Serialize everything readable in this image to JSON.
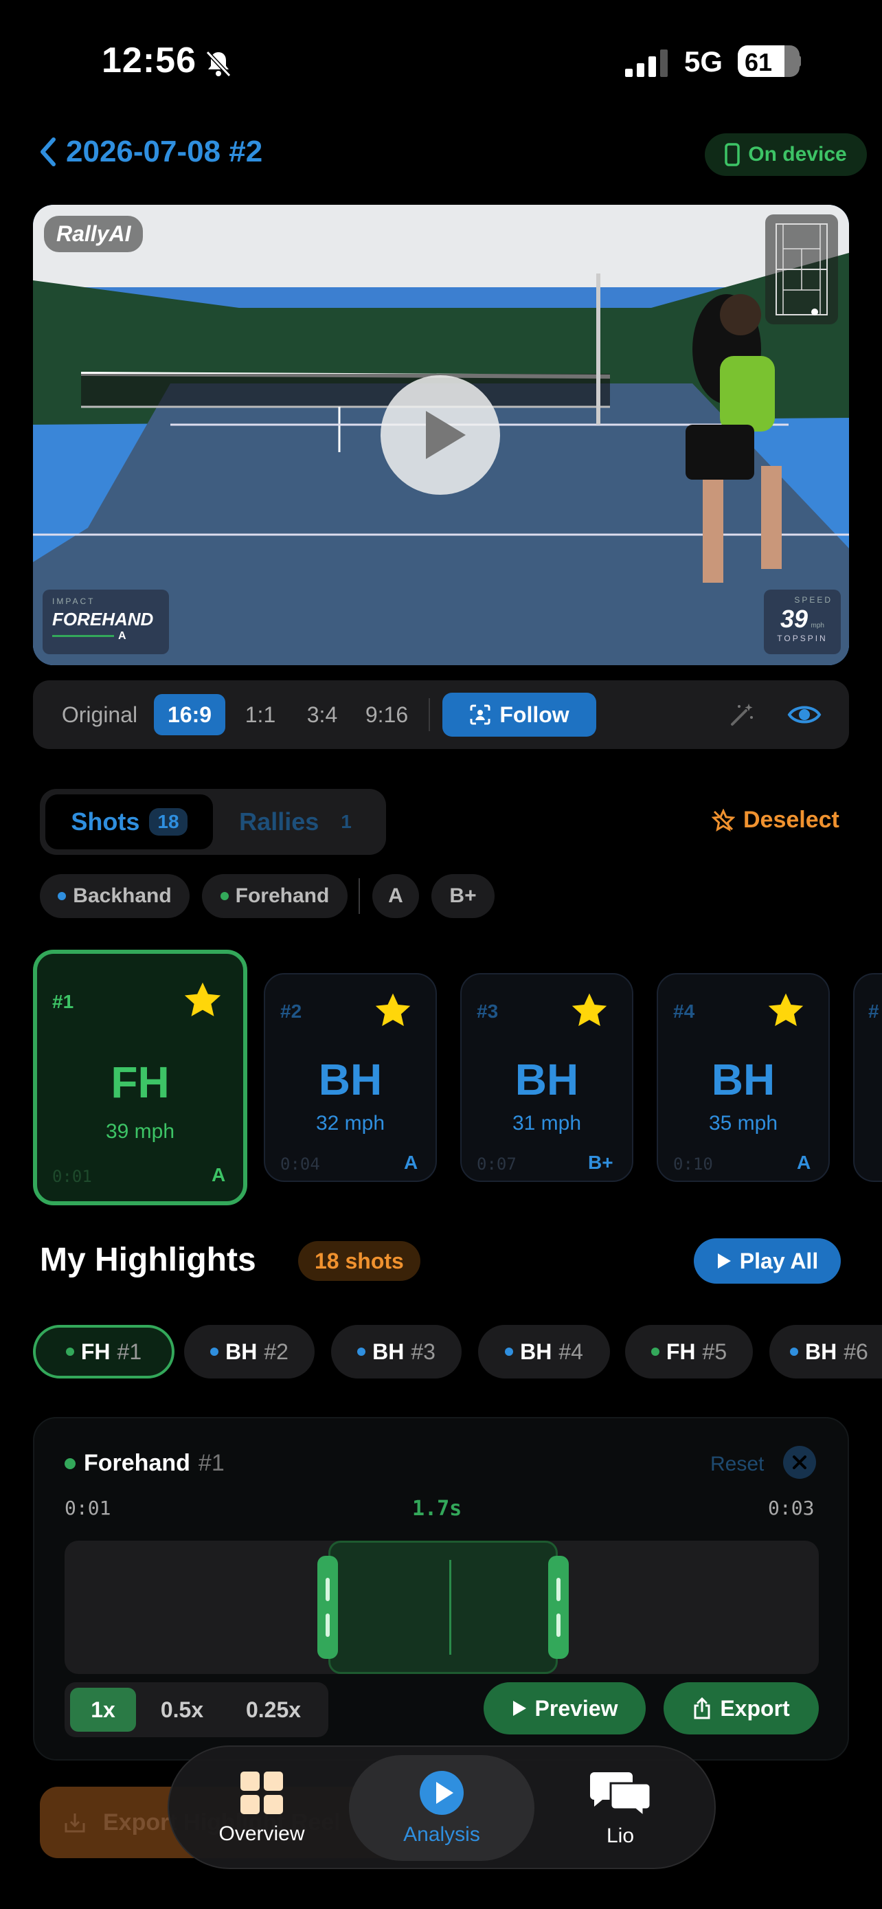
{
  "status": {
    "time": "12:56",
    "network": "5G",
    "battery": "61"
  },
  "header": {
    "title": "2026-07-08 #2",
    "on_device": "On device"
  },
  "video": {
    "watermark": "RallyAI",
    "impact_label": "IMPACT",
    "impact_value": "FOREHAND",
    "impact_grade": "A",
    "speed_label": "SPEED",
    "speed_value": "39",
    "speed_unit": "mph",
    "spin": "TOPSPIN"
  },
  "aspect": {
    "options": [
      "Original",
      "16:9",
      "1:1",
      "3:4",
      "9:16"
    ],
    "selected": "16:9",
    "follow_label": "Follow"
  },
  "segment": {
    "shots_label": "Shots",
    "shots_count": "18",
    "rallies_label": "Rallies",
    "rallies_count": "1",
    "deselect_label": "Deselect"
  },
  "filters": [
    {
      "label": "Backhand",
      "color": "#2f8fdf"
    },
    {
      "label": "Forehand",
      "color": "#33a85a"
    },
    {
      "label": "A"
    },
    {
      "label": "B+"
    }
  ],
  "shots": [
    {
      "num": "#1",
      "type": "FH",
      "speed": "39 mph",
      "time": "0:01",
      "grade": "A",
      "selected": true
    },
    {
      "num": "#2",
      "type": "BH",
      "speed": "32 mph",
      "time": "0:04",
      "grade": "A"
    },
    {
      "num": "#3",
      "type": "BH",
      "speed": "31 mph",
      "time": "0:07",
      "grade": "B+"
    },
    {
      "num": "#4",
      "type": "BH",
      "speed": "35 mph",
      "time": "0:10",
      "grade": "A"
    },
    {
      "num": "#"
    }
  ],
  "highlights": {
    "title": "My Highlights",
    "badge": "18 shots",
    "play_all": "Play All",
    "chips": [
      {
        "type": "FH",
        "num": "#1",
        "color": "#33a85a",
        "selected": true
      },
      {
        "type": "BH",
        "num": "#2",
        "color": "#2f8fdf"
      },
      {
        "type": "BH",
        "num": "#3",
        "color": "#2f8fdf"
      },
      {
        "type": "BH",
        "num": "#4",
        "color": "#2f8fdf"
      },
      {
        "type": "FH",
        "num": "#5",
        "color": "#33a85a"
      },
      {
        "type": "BH",
        "num": "#6",
        "color": "#2f8fdf"
      }
    ]
  },
  "trim": {
    "title": "Forehand",
    "num": "#1",
    "reset": "Reset",
    "start": "0:01",
    "duration": "1.7s",
    "end": "0:03",
    "speeds": [
      "1x",
      "0.5x",
      "0.25x"
    ],
    "selected_speed": "1x",
    "preview": "Preview",
    "export": "Export"
  },
  "export_all": "Export Highlight Reel",
  "tabs": [
    {
      "label": "Overview",
      "icon": "grid-icon"
    },
    {
      "label": "Analysis",
      "icon": "play-circle-icon",
      "active": true
    },
    {
      "label": "Lio",
      "icon": "chat-bubbles-icon"
    }
  ]
}
